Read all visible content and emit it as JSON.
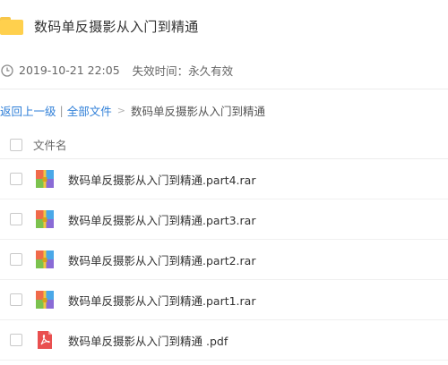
{
  "header": {
    "title": "数码单反摄影从入门到精通",
    "icon": "folder-icon"
  },
  "meta": {
    "datetime": "2019-10-21 22:05",
    "expire": "失效时间：永久有效"
  },
  "breadcrumb": {
    "back": "返回上一级",
    "separator": "|",
    "all_files": "全部文件",
    "arrow": ">",
    "current": "数码单反摄影从入门到精通"
  },
  "table": {
    "column_name": "文件名",
    "files": [
      {
        "name": "数码单反摄影从入门到精通.part4.rar",
        "icon": "rar-icon"
      },
      {
        "name": "数码单反摄影从入门到精通.part3.rar",
        "icon": "rar-icon"
      },
      {
        "name": "数码单反摄影从入门到精通.part2.rar",
        "icon": "rar-icon"
      },
      {
        "name": "数码单反摄影从入门到精通.part1.rar",
        "icon": "rar-icon"
      },
      {
        "name": "数码单反摄影从入门到精通 .pdf",
        "icon": "pdf-icon"
      }
    ]
  },
  "colors": {
    "link": "#2f7fd8",
    "folder": "#ffd04d",
    "pdf": "#e94f4f"
  }
}
